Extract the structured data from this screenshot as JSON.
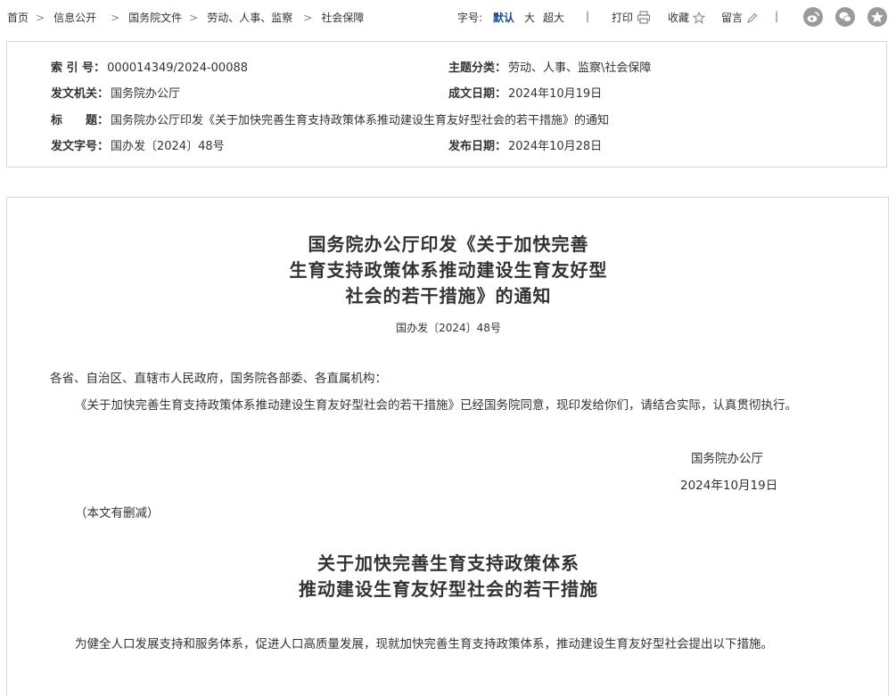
{
  "breadcrumb": {
    "items": [
      "首页",
      "信息公开",
      "国务院文件",
      "劳动、人事、监察",
      "社会保障"
    ],
    "separator": ">"
  },
  "toolbar": {
    "font_size_label": "字号:",
    "font_default": "默认",
    "font_large": "大",
    "font_xlarge": "超大",
    "print_label": "打印",
    "favorite_label": "收藏",
    "comment_label": "留言",
    "divider": "|"
  },
  "share": {
    "icons": [
      "weibo-icon",
      "wechat-icon",
      "star-share-icon"
    ]
  },
  "info": {
    "index_label": "索 引 号：",
    "index_value": "000014349/2024-00088",
    "category_label": "主题分类：",
    "category_value": "劳动、人事、监察\\社会保障",
    "issuer_label": "发文机关：",
    "issuer_value": "国务院办公厅",
    "created_label": "成文日期：",
    "created_value": "2024年10月19日",
    "title_label": "标　　题：",
    "title_value": "国务院办公厅印发《关于加快完善生育支持政策体系推动建设生育友好型社会的若干措施》的通知",
    "docno_label": "发文字号：",
    "docno_value": "国办发〔2024〕48号",
    "published_label": "发布日期：",
    "published_value": "2024年10月28日"
  },
  "article": {
    "title_lines": [
      "国务院办公厅印发《关于加快完善",
      "生育支持政策体系推动建设生育友好型",
      "社会的若干措施》的通知"
    ],
    "doc_number": "国办发〔2024〕48号",
    "salutation": "各省、自治区、直辖市人民政府，国务院各部委、各直属机构：",
    "body_paragraph": "《关于加快完善生育支持政策体系推动建设生育友好型社会的若干措施》已经国务院同意，现印发给你们，请结合实际，认真贯彻执行。",
    "signature_org": "国务院办公厅",
    "signature_date": "2024年10月19日",
    "note": "（本文有删减）",
    "subtitle_lines": [
      "关于加快完善生育支持政策体系",
      "推动建设生育友好型社会的若干措施"
    ],
    "intro_paragraph": "为健全人口发展支持和服务体系，促进人口高质量发展，现就加快完善生育支持政策体系，推动建设生育友好型社会提出以下措施。"
  }
}
